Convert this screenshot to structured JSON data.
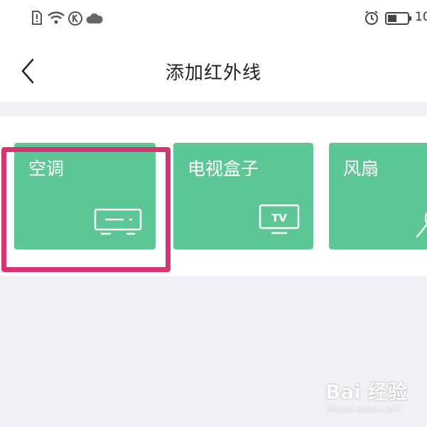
{
  "status_bar": {
    "battery_text": "10",
    "icons": [
      "sim-alert-icon",
      "wifi-icon",
      "k-badge-icon",
      "cloud-icon",
      "alarm-icon",
      "battery-icon"
    ]
  },
  "header": {
    "back_icon": "chevron-left-icon",
    "title": "添加红外线"
  },
  "cards": [
    {
      "label": "空调",
      "icon": "air-conditioner-icon",
      "selected": true
    },
    {
      "label": "电视盒子",
      "icon": "tv-icon",
      "icon_text": "TV"
    },
    {
      "label": "风扇",
      "icon": "fan-icon"
    }
  ],
  "colors": {
    "card_green": "#5cc694",
    "highlight_pink": "#d63573",
    "background": "#f1f1f5"
  },
  "watermark": {
    "text": "Bai 经验",
    "sub": "jingyan.baidu.com"
  }
}
